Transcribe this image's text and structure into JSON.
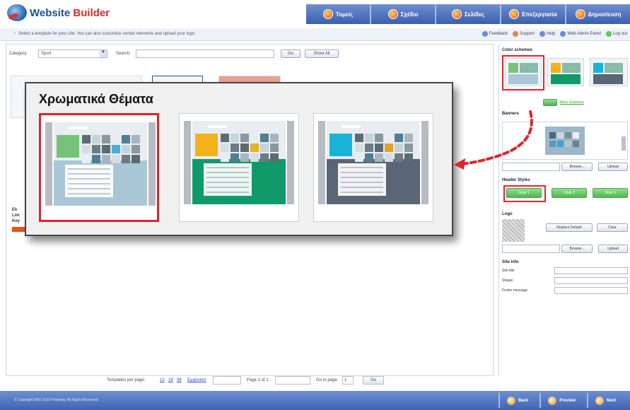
{
  "header": {
    "app_title_part1": "Website",
    "app_title_part2": "Builder",
    "steps": [
      {
        "label": "Τομείς"
      },
      {
        "label": "Σχέδιο"
      },
      {
        "label": "Σελίδες"
      },
      {
        "label": "Επεξεργασία"
      },
      {
        "label": "Δημοσίευση"
      }
    ]
  },
  "infobar": {
    "hint": "Select a template for your site. You can also customize certain elements and upload your logo.",
    "links": [
      "Feedback",
      "Support",
      "Help",
      "Web Admin Panel",
      "Log out"
    ]
  },
  "filter": {
    "category_label": "Category:",
    "category_value": "Sport",
    "category_arrow": "▼",
    "search_label": "Search:",
    "search_value": "",
    "go_button": "Go",
    "show_all_button": "Show All"
  },
  "left_strip": {
    "lines": [
      "Ek",
      "Lim",
      "Key"
    ]
  },
  "pagination": {
    "per_page_label": "Templates per page:",
    "per_page_options": [
      "12",
      "18",
      "36",
      "Εμφάνιση"
    ],
    "page_label": "Page 1 of 1",
    "goto_label": "Go to page:",
    "goto_value": "1",
    "go_button": "Go"
  },
  "right_panel": {
    "color_schemes_title": "Color schemes",
    "more_link": "More Schemes",
    "banner_title": "Banners",
    "browse_label": "Browse...",
    "upload_label": "Upload",
    "header_styles_title": "Header Styles",
    "header_styles": [
      "Style 1",
      "Style 2",
      "Style 3"
    ],
    "logo_title": "Logo",
    "logo_replace_button": "Replace Default",
    "logo_clear_button": "Clear",
    "logo_browse": "Browse...",
    "logo_upload": "Upload",
    "site_info_title": "Site info",
    "site_fields": [
      {
        "label": "Site title",
        "value": ""
      },
      {
        "label": "Slogan",
        "value": ""
      },
      {
        "label": "Footer message",
        "value": ""
      }
    ]
  },
  "callout": {
    "title": "Χρωματικά Θέματα",
    "themes": [
      {
        "name": "theme-blue",
        "hero": "#77c27a",
        "band": "#a9c7d6",
        "accent": "#4aaed4",
        "selected": true
      },
      {
        "name": "theme-green",
        "hero": "#f3b21a",
        "band": "#109a69",
        "accent": "#e9b125",
        "selected": false
      },
      {
        "name": "theme-slate",
        "hero": "#18b4d8",
        "band": "#5a6576",
        "accent": "#e2a32a",
        "selected": false
      }
    ]
  },
  "footer": {
    "copyright": "© Copyright 2007-2010 Hostway, All Rights Reserved",
    "back": "Back",
    "preview": "Preview",
    "next": "Next"
  },
  "colors": {
    "brand_blue": "#1d4e96",
    "brand_red": "#d42c2c",
    "highlight_red": "#e0232c",
    "nav_blue": "#3d63b3"
  }
}
